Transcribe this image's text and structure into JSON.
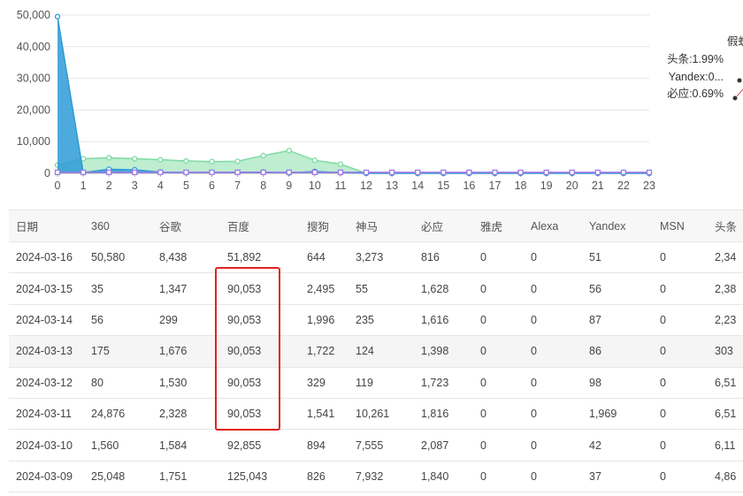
{
  "chart_data": {
    "type": "area",
    "x": [
      0,
      1,
      2,
      3,
      4,
      5,
      6,
      7,
      8,
      9,
      10,
      11,
      12,
      13,
      14,
      15,
      16,
      17,
      18,
      19,
      20,
      21,
      22,
      23
    ],
    "ylim": [
      0,
      50000
    ],
    "yticks": [
      "0",
      "10,000",
      "20,000",
      "30,000",
      "40,000",
      "50,000"
    ],
    "series": [
      {
        "color": "#2e9bd6",
        "values": [
          49500,
          200,
          1300,
          1100,
          400,
          200,
          300,
          300,
          400,
          100,
          600,
          200,
          0,
          0,
          0,
          0,
          0,
          0,
          0,
          0,
          0,
          0,
          0,
          0
        ]
      },
      {
        "color": "#7ddba2",
        "values": [
          2600,
          4600,
          4900,
          4600,
          4300,
          3900,
          3700,
          3800,
          5600,
          7200,
          4100,
          2900,
          0,
          0,
          0,
          0,
          0,
          0,
          0,
          0,
          0,
          0,
          0,
          0
        ]
      },
      {
        "color": "#9b7be6",
        "values": [
          300,
          300,
          300,
          300,
          300,
          300,
          300,
          300,
          300,
          300,
          300,
          300,
          300,
          300,
          300,
          300,
          300,
          300,
          300,
          300,
          300,
          300,
          300,
          300
        ]
      }
    ],
    "grid": true
  },
  "legend": {
    "title": "假蜘",
    "items": [
      "头条:1.99%",
      "Yandex:0...",
      "必应:0.69%"
    ]
  },
  "table": {
    "headers": [
      "日期",
      "360",
      "谷歌",
      "百度",
      "搜狗",
      "神马",
      "必应",
      "雅虎",
      "Alexa",
      "Yandex",
      "MSN",
      "头条"
    ],
    "rows": [
      [
        "2024-03-16",
        "50,580",
        "8,438",
        "51,892",
        "644",
        "3,273",
        "816",
        "0",
        "0",
        "51",
        "0",
        "2,34"
      ],
      [
        "2024-03-15",
        "35",
        "1,347",
        "90,053",
        "2,495",
        "55",
        "1,628",
        "0",
        "0",
        "56",
        "0",
        "2,38"
      ],
      [
        "2024-03-14",
        "56",
        "299",
        "90,053",
        "1,996",
        "235",
        "1,616",
        "0",
        "0",
        "87",
        "0",
        "2,23"
      ],
      [
        "2024-03-13",
        "175",
        "1,676",
        "90,053",
        "1,722",
        "124",
        "1,398",
        "0",
        "0",
        "86",
        "0",
        "303"
      ],
      [
        "2024-03-12",
        "80",
        "1,530",
        "90,053",
        "329",
        "119",
        "1,723",
        "0",
        "0",
        "98",
        "0",
        "6,51"
      ],
      [
        "2024-03-11",
        "24,876",
        "2,328",
        "90,053",
        "1,541",
        "10,261",
        "1,816",
        "0",
        "0",
        "1,969",
        "0",
        "6,51"
      ],
      [
        "2024-03-10",
        "1,560",
        "1,584",
        "92,855",
        "894",
        "7,555",
        "2,087",
        "0",
        "0",
        "42",
        "0",
        "6,11"
      ],
      [
        "2024-03-09",
        "25,048",
        "1,751",
        "125,043",
        "826",
        "7,932",
        "1,840",
        "0",
        "0",
        "37",
        "0",
        "4,86"
      ]
    ]
  }
}
